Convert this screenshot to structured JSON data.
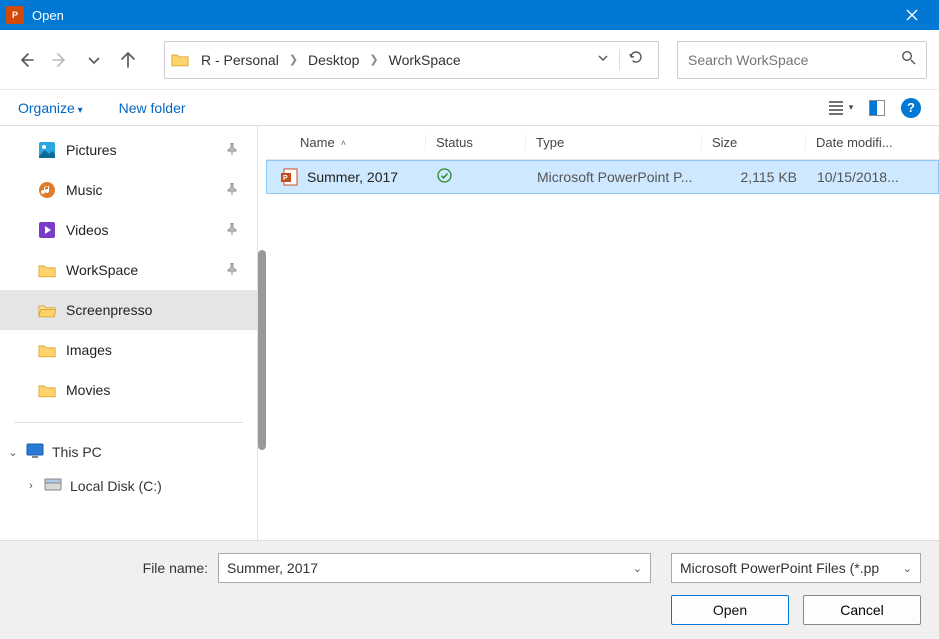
{
  "window": {
    "title": "Open"
  },
  "breadcrumb": {
    "root": "R - Personal",
    "mid": "Desktop",
    "leaf": "WorkSpace"
  },
  "search": {
    "placeholder": "Search WorkSpace"
  },
  "toolbar": {
    "organize": "Organize",
    "newfolder": "New folder"
  },
  "nav": {
    "items": [
      {
        "label": "Pictures",
        "icon": "pictures",
        "pinned": true,
        "selected": false
      },
      {
        "label": "Music",
        "icon": "music",
        "pinned": true,
        "selected": false
      },
      {
        "label": "Videos",
        "icon": "videos",
        "pinned": true,
        "selected": false
      },
      {
        "label": "WorkSpace",
        "icon": "folder",
        "pinned": true,
        "selected": false
      },
      {
        "label": "Screenpresso",
        "icon": "folder-open",
        "pinned": false,
        "selected": true
      },
      {
        "label": "Images",
        "icon": "folder",
        "pinned": false,
        "selected": false
      },
      {
        "label": "Movies",
        "icon": "folder",
        "pinned": false,
        "selected": false
      }
    ],
    "thispc": "This PC",
    "localdisk": "Local Disk (C:)"
  },
  "columns": {
    "name": "Name",
    "status": "Status",
    "type": "Type",
    "size": "Size",
    "date": "Date modifi..."
  },
  "files": [
    {
      "name": "Summer, 2017",
      "status_ok": true,
      "type": "Microsoft PowerPoint P...",
      "size": "2,115 KB",
      "date": "10/15/2018...",
      "selected": true
    }
  ],
  "footer": {
    "filename_label": "File name:",
    "filename_value": "Summer, 2017",
    "filetype_value": "Microsoft PowerPoint Files (*.pp",
    "open": "Open",
    "cancel": "Cancel"
  }
}
